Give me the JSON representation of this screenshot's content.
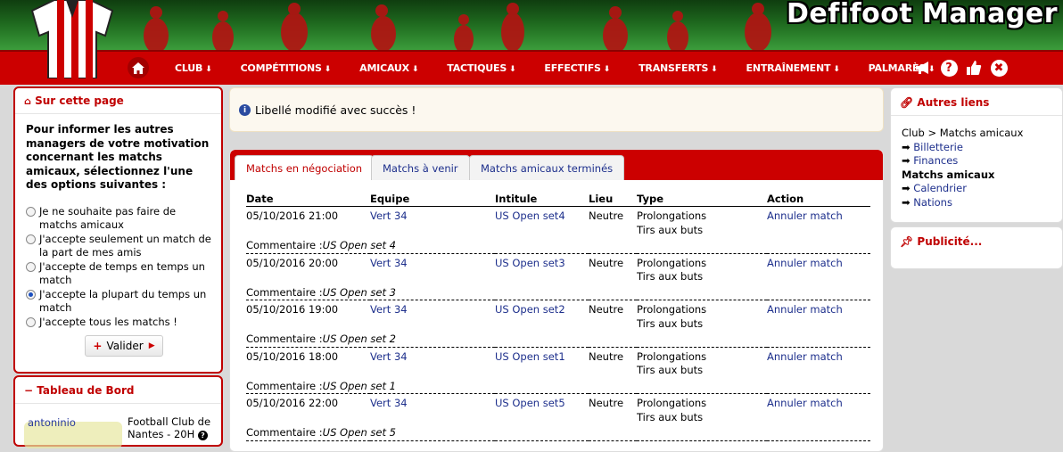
{
  "app": {
    "brand": "Defifoot Manager"
  },
  "nav": {
    "items": [
      {
        "label": "CLUB"
      },
      {
        "label": "COMPÉTITIONS"
      },
      {
        "label": "AMICAUX"
      },
      {
        "label": "TACTIQUES"
      },
      {
        "label": "EFFECTIFS"
      },
      {
        "label": "TRANSFERTS"
      },
      {
        "label": "ENTRAÎNEMENT"
      },
      {
        "label": "PALMARÈS"
      }
    ],
    "icons": [
      "home-icon",
      "megaphone-icon",
      "help-icon",
      "thumbs-up-icon",
      "close-icon"
    ]
  },
  "left": {
    "title": "Sur cette page",
    "intro": "Pour informer les autres managers de votre motivation concernant les matchs amicaux, sélectionnez l'une des options suivantes :",
    "options": [
      {
        "label": "Je ne souhaite pas faire de matchs amicaux",
        "checked": false
      },
      {
        "label": "J'accepte seulement un match de la part de mes amis",
        "checked": false
      },
      {
        "label": "J'accepte de temps en temps un match",
        "checked": false
      },
      {
        "label": "J'accepte la plupart du temps un match",
        "checked": true
      },
      {
        "label": "J'accepte tous les matchs !",
        "checked": false
      }
    ],
    "submit_label": "Valider"
  },
  "dashboard": {
    "title": "Tableau de Bord",
    "user": "antoninio",
    "club_line1": "Football Club de",
    "club_line2": "Nantes -  20H"
  },
  "message": {
    "text": "Libellé modifié avec succès !"
  },
  "tabs": [
    {
      "label": "Matchs en négociation",
      "active": true
    },
    {
      "label": "Matchs à venir",
      "active": false
    },
    {
      "label": "Matchs amicaux terminés",
      "active": false
    }
  ],
  "table": {
    "headers": [
      "Date",
      "Equipe",
      "Intitule",
      "Lieu",
      "Type",
      "Action"
    ],
    "comment_label": "Commentaire :",
    "rows": [
      {
        "date": "05/10/2016 21:00",
        "team": "Vert 34",
        "title": "US Open set4",
        "place": "Neutre",
        "type1": "Prolongations",
        "type2": "Tirs aux buts",
        "action": "Annuler match",
        "comment": "US Open set 4"
      },
      {
        "date": "05/10/2016 20:00",
        "team": "Vert 34",
        "title": "US Open set3",
        "place": "Neutre",
        "type1": "Prolongations",
        "type2": "Tirs aux buts",
        "action": "Annuler match",
        "comment": "US Open set 3"
      },
      {
        "date": "05/10/2016 19:00",
        "team": "Vert 34",
        "title": "US Open set2",
        "place": "Neutre",
        "type1": "Prolongations",
        "type2": "Tirs aux buts",
        "action": "Annuler match",
        "comment": "US Open set 2"
      },
      {
        "date": "05/10/2016 18:00",
        "team": "Vert 34",
        "title": "US Open set1",
        "place": "Neutre",
        "type1": "Prolongations",
        "type2": "Tirs aux buts",
        "action": "Annuler match",
        "comment": "US Open set 1"
      },
      {
        "date": "05/10/2016 22:00",
        "team": "Vert 34",
        "title": "US Open set5",
        "place": "Neutre",
        "type1": "Prolongations",
        "type2": "Tirs aux buts",
        "action": "Annuler match",
        "comment": "US Open set 5"
      }
    ]
  },
  "right": {
    "title": "Autres liens",
    "breadcrumb": "Club > Matchs amicaux",
    "links1": [
      "Billetterie",
      "Finances"
    ],
    "section": "Matchs amicaux",
    "links2": [
      "Calendrier",
      "Nations"
    ]
  },
  "ads": {
    "title": "Publicité..."
  },
  "colors": {
    "brand_red": "#cc0000",
    "link_blue": "#1d2f8c",
    "header_green": "#1c7a1c"
  }
}
